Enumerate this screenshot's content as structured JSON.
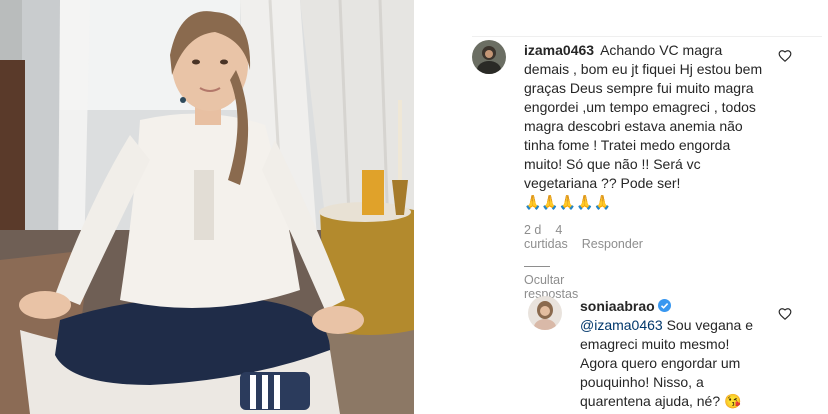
{
  "comments": [
    {
      "username": "izama0463",
      "text": "Achando VC magra demais , bom eu jt fiquei Hj estou bem graças Deus sempre fui muito magra engordei ,um tempo emagreci , todos magra descobri estava anemia não tinha fome ! Tratei medo engorda muito! Só que não !! Será vc vegetariana ?? Pode ser!",
      "emoji": "🙏🙏🙏🙏🙏",
      "time": "2 d",
      "likes": "4 curtidas",
      "reply_label": "Responder",
      "hide_replies_label": "Ocultar respostas"
    },
    {
      "username": "soniaabrao",
      "verified": true,
      "mention": "@izama0463",
      "text": " Sou vegana e emagreci muito mesmo! Agora quero engordar um pouquinho! Nisso, a quarentena ajuda, né?",
      "emoji": "😘"
    }
  ],
  "icons": {
    "like": "heart-outline-icon",
    "verified": "verified-badge-icon"
  },
  "colors": {
    "text": "#262626",
    "meta": "#8e8e8e",
    "mention": "#00376b",
    "verified": "#3897f0"
  }
}
